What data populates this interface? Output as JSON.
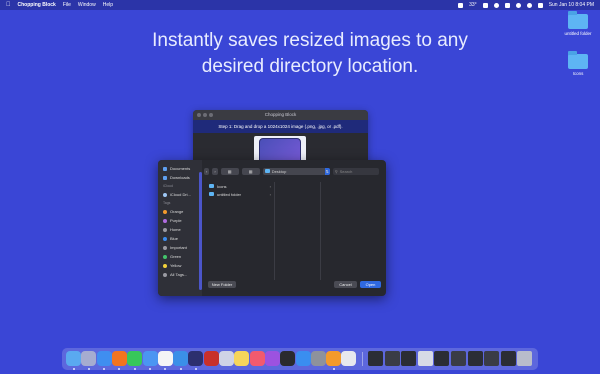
{
  "menubar": {
    "app_name": "Chopping Block",
    "menus": [
      "File",
      "Window",
      "Help"
    ],
    "temp": "33°",
    "datetime": "Sun Jan 10  8:04 PM"
  },
  "headline": {
    "line1": "Instantly saves resized images to any",
    "line2": "desired directory location."
  },
  "desktop_icons": [
    {
      "label": "untitled folder"
    },
    {
      "label": "Icons"
    }
  ],
  "app_window": {
    "title": "Chopping Block",
    "step_text": "Step 1: Drag and drop a 1024x1024 image (.png, .jpg, or .pdf)."
  },
  "dialog": {
    "favorites": [
      "Documents",
      "Downloads"
    ],
    "icloud_header": "iCloud",
    "icloud_item": "iCloud Dri...",
    "tags_header": "Tags",
    "tags": [
      {
        "label": "Orange",
        "color": "#f39a2b"
      },
      {
        "label": "Purple",
        "color": "#b06be0"
      },
      {
        "label": "Home",
        "color": "#9a9aa2"
      },
      {
        "label": "Blue",
        "color": "#3b8cf0"
      },
      {
        "label": "Important",
        "color": "#9a9aa2"
      },
      {
        "label": "Green",
        "color": "#43c46b"
      },
      {
        "label": "Yellow",
        "color": "#f3d23b"
      },
      {
        "label": "All Tags...",
        "color": "#9a9aa2"
      }
    ],
    "location": "Desktop",
    "search_placeholder": "Search",
    "files": [
      "Icons",
      "untitled folder"
    ],
    "new_folder": "New Folder",
    "cancel": "Cancel",
    "open": "Open"
  },
  "dock": {
    "apps": [
      {
        "name": "finder",
        "color": "#5aa9f0"
      },
      {
        "name": "launchpad",
        "color": "#a6acd0"
      },
      {
        "name": "safari",
        "color": "#3f8ef0"
      },
      {
        "name": "firefox",
        "color": "#f2741f"
      },
      {
        "name": "messages",
        "color": "#37c75a"
      },
      {
        "name": "mail",
        "color": "#4b95f2"
      },
      {
        "name": "calendar",
        "color": "#f4f4f6"
      },
      {
        "name": "xcode",
        "color": "#3b8fe8"
      },
      {
        "name": "chopping-block",
        "color": "#2c2f6e"
      },
      {
        "name": "filezilla",
        "color": "#c8302a"
      },
      {
        "name": "preview",
        "color": "#cfd3e6"
      },
      {
        "name": "notes",
        "color": "#f6d55b"
      },
      {
        "name": "music",
        "color": "#f25a6e"
      },
      {
        "name": "podcasts",
        "color": "#9c52e0"
      },
      {
        "name": "tv",
        "color": "#2a2a2e"
      },
      {
        "name": "app-store",
        "color": "#3a8ef0"
      },
      {
        "name": "system-preferences",
        "color": "#8e929c"
      },
      {
        "name": "pages",
        "color": "#f39a2b"
      },
      {
        "name": "textedit",
        "color": "#e8e8ee"
      }
    ],
    "windows": [
      {
        "name": "window-1",
        "color": "#2b2d35"
      },
      {
        "name": "window-2",
        "color": "#3a3c46"
      },
      {
        "name": "window-3",
        "color": "#2b2d35"
      },
      {
        "name": "window-4",
        "color": "#d7dae6"
      },
      {
        "name": "window-5",
        "color": "#2b2d35"
      },
      {
        "name": "window-6",
        "color": "#3a3c46"
      },
      {
        "name": "window-7",
        "color": "#2b2d35"
      },
      {
        "name": "window-8",
        "color": "#3a3c46"
      },
      {
        "name": "window-9",
        "color": "#2b2d35"
      },
      {
        "name": "trash",
        "color": "#b8bccb"
      }
    ]
  }
}
